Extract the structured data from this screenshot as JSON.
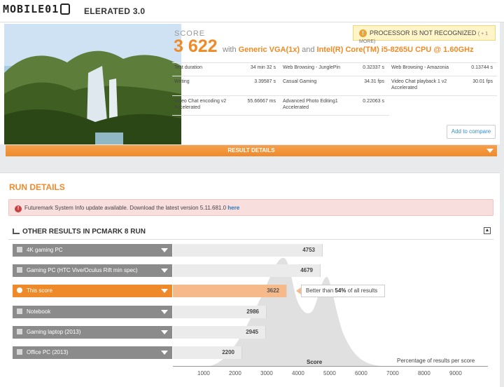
{
  "header": {
    "logo": "MOBILE01",
    "benchmark_title": "ELERATED 3.0"
  },
  "result": {
    "score_label": "SCORE",
    "score_value": "3 622",
    "with_text": "with",
    "gpu": "Generic VGA(1x)",
    "and_text": "and",
    "cpu": "Intel(R) Core(TM) i5-8265U CPU @ 1.60GHz",
    "warning": "PROCESSOR IS NOT RECOGNIZED",
    "warning_more": "( + 1 MORE)",
    "add_compare": "Add to compare",
    "details_bar": "RESULT DETAILS",
    "stats": [
      {
        "name": "Test duration",
        "value": "34 min 32 s"
      },
      {
        "name": "Web Browsing - JunglePin",
        "value": "0.32337 s"
      },
      {
        "name": "Web Browsing - Amazonia",
        "value": "0.13744 s"
      },
      {
        "name": "Writing",
        "value": "3.39587 s"
      },
      {
        "name": "Casual Gaming",
        "value": "34.31 fps"
      },
      {
        "name": "Video Chat playback 1 v2 Accelerated",
        "value": "30.01 fps"
      },
      {
        "name": "Video Chat encoding v2 Accelerated",
        "value": "55.66667 ms"
      },
      {
        "name": "Advanced Photo Editing1 Accelerated",
        "value": "0.22063 s"
      }
    ]
  },
  "run": {
    "title": "RUN DETAILS",
    "alert_text": "Futuremark System Info update available. Download the latest version 5.11.681.0",
    "alert_link": "here",
    "other_title": "OTHER RESULTS IN PCMARK 8 RUN",
    "collapse": "▲"
  },
  "tooltip": {
    "before": "Better than",
    "percent": "54%",
    "after": "of all results"
  },
  "chart_data": {
    "type": "bar",
    "categories": [
      "4K gaming PC",
      "Gaming PC (HTC Vive/Oculus Rift min spec)",
      "This score",
      "Notebook",
      "Gaming laptop (2013)",
      "Office PC (2013)"
    ],
    "values": [
      4753,
      4679,
      3622,
      2986,
      2945,
      2200
    ],
    "xlabel": "Score",
    "ylabel": "Percentage of results per score",
    "xticks": [
      "1000",
      "2000",
      "3000",
      "4000",
      "5000",
      "6000",
      "7000",
      "8000",
      "9000"
    ],
    "xlim": [
      0,
      10000
    ],
    "highlight": "This score",
    "colors": {
      "accent": "#ef8a2b",
      "bar": "#ebebeb",
      "highlight_bar": "#f5b98a",
      "control": "#8b8b8b"
    }
  }
}
